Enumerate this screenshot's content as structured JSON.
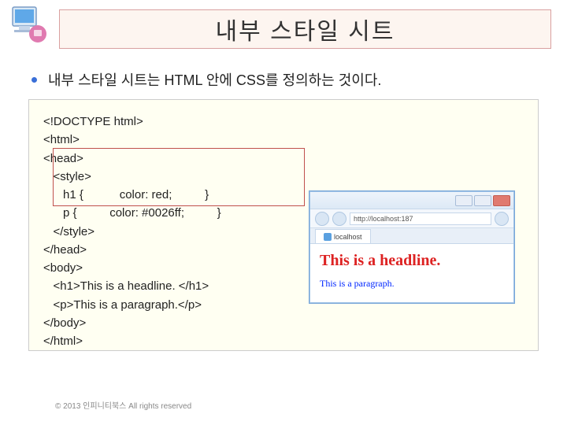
{
  "header": {
    "title": "내부 스타일 시트"
  },
  "bullet": {
    "text": "내부 스타일 시트는 HTML 안에 CSS를 정의하는 것이다."
  },
  "code": {
    "line1": "<!DOCTYPE html>",
    "line2": "<html>",
    "line3": "<head>",
    "line4": "   <style>",
    "line5": "      h1 {           color: red;          }",
    "line6": "      p {          color: #0026ff;          }",
    "line7": "   </style>",
    "line8": "</head>",
    "line9": "<body>",
    "line10": "   <h1>This is a headline. </h1>",
    "line11": "   <p>This is a paragraph.</p>",
    "line12": "</body>",
    "line13": "</html>"
  },
  "preview": {
    "url": "http://localhost:187",
    "tabLabel": "localhost",
    "headline": "This is a headline.",
    "paragraph": "This is a paragraph."
  },
  "footer": {
    "copyright": "© 2013 인피니티북스 All rights reserved"
  }
}
